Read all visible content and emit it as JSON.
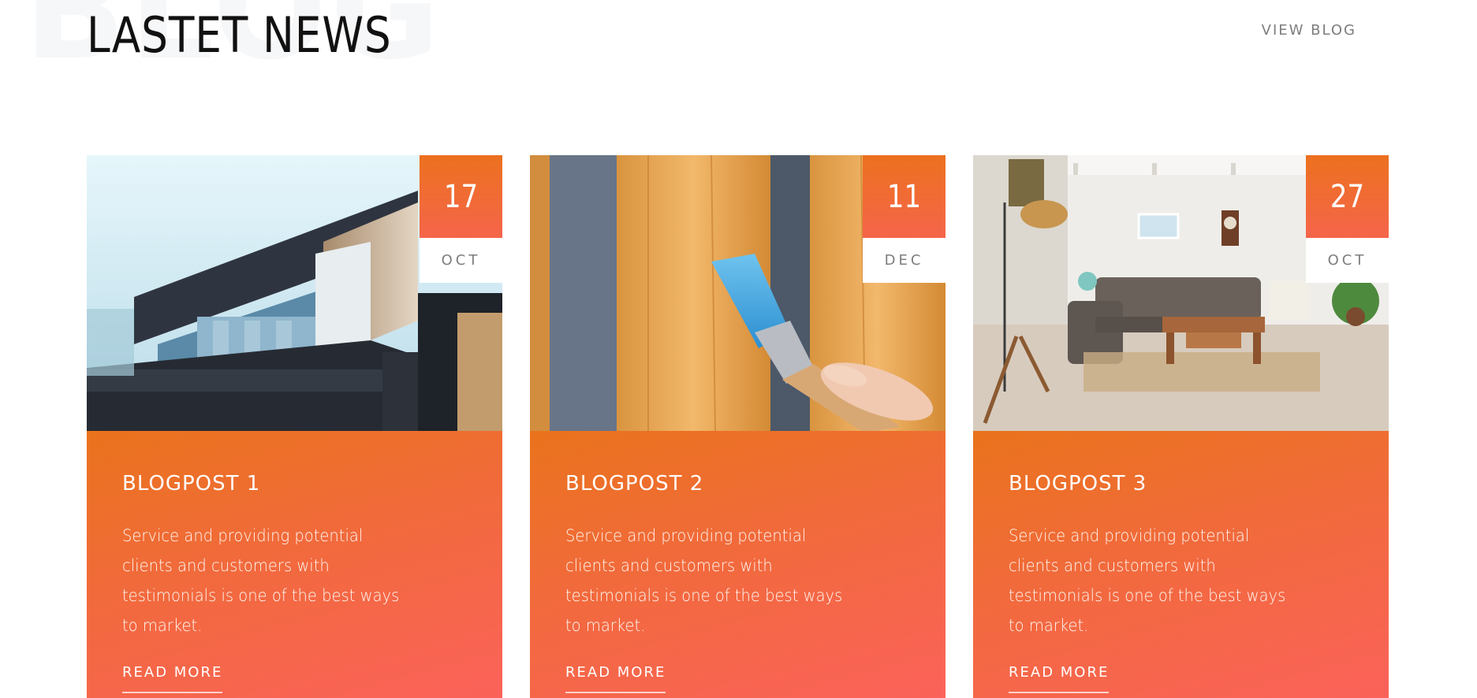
{
  "section": {
    "background_word": "BLOG",
    "title": "LASTET NEWS",
    "view_blog_label": "VIEW BLOG"
  },
  "colors": {
    "accent_top": "#ec711f",
    "accent_bottom": "#fb625a",
    "title": "#111111",
    "muted": "#7d7d7d"
  },
  "posts": [
    {
      "day": "17",
      "month": "OCT",
      "title": "BLOGPOST 1",
      "excerpt": "Service and providing potential clients and customers with testimonials is one of the best ways to market.",
      "read_more": "READ MORE",
      "image": "modern-house-photo"
    },
    {
      "day": "11",
      "month": "DEC",
      "title": "BLOGPOST 2",
      "excerpt": "Service and providing potential clients and customers with testimonials is one of the best ways to market.",
      "read_more": "READ MORE",
      "image": "paintbrush-on-wood-photo"
    },
    {
      "day": "27",
      "month": "OCT",
      "title": "BLOGPOST 3",
      "excerpt": "Service and providing potential clients and customers with testimonials is one of the best ways to market.",
      "read_more": "READ MORE",
      "image": "living-room-photo"
    }
  ]
}
